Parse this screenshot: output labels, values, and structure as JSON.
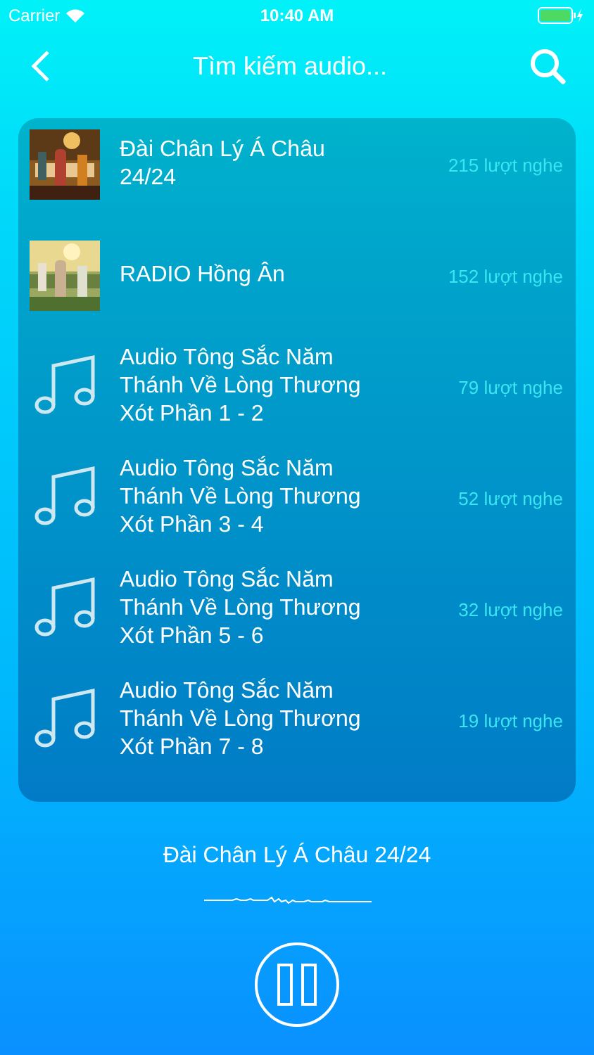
{
  "status_bar": {
    "carrier": "Carrier",
    "time": "10:40 AM"
  },
  "nav": {
    "title": "Tìm kiếm audio..."
  },
  "items": [
    {
      "kind": "picture",
      "title": "Đài Chân Lý Á Châu 24/24",
      "plays": "215 lượt nghe"
    },
    {
      "kind": "picture",
      "title": "RADIO Hồng Ân",
      "plays": "152 lượt nghe"
    },
    {
      "kind": "audio",
      "title": "Audio Tông Sắc Năm Thánh Về Lòng Thương Xót Phần 1 - 2",
      "plays": "79 lượt nghe"
    },
    {
      "kind": "audio",
      "title": "Audio Tông Sắc Năm Thánh Về Lòng Thương Xót Phần 3 - 4",
      "plays": "52 lượt nghe"
    },
    {
      "kind": "audio",
      "title": "Audio Tông Sắc Năm Thánh Về Lòng Thương Xót Phần 5 - 6",
      "plays": "32 lượt nghe"
    },
    {
      "kind": "audio",
      "title": "Audio Tông Sắc Năm Thánh Về Lòng Thương Xót Phần 7 - 8",
      "plays": "19 lượt nghe"
    }
  ],
  "now_playing": {
    "title": "Đài Chân Lý Á Châu 24/24",
    "playing": true
  }
}
